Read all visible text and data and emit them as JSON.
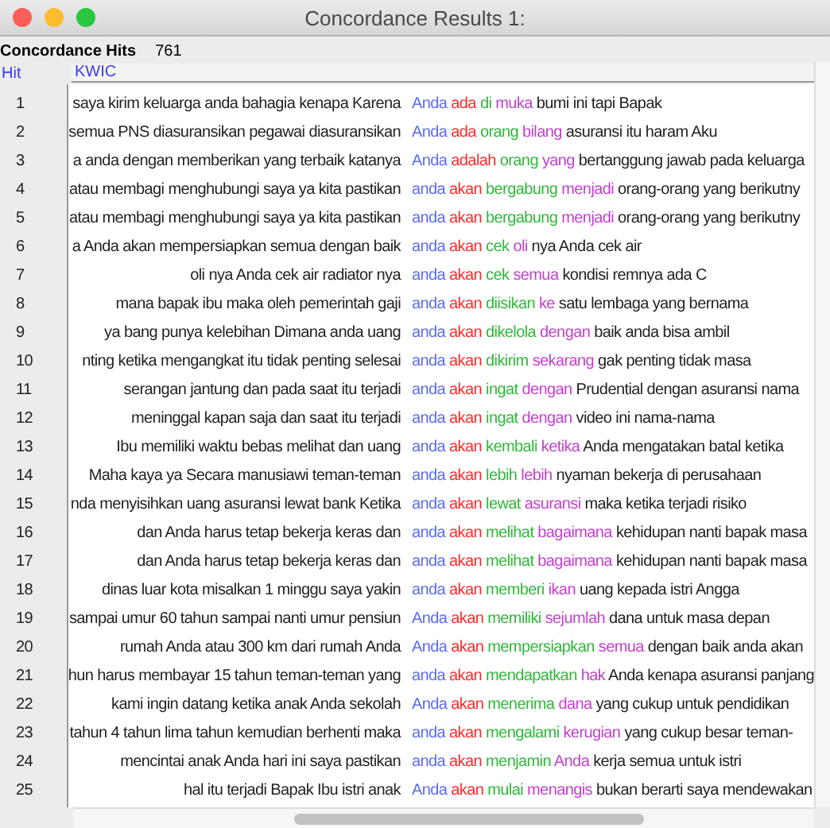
{
  "window": {
    "title": "Concordance Results 1:"
  },
  "summary": {
    "label": "Concordance Hits",
    "value": "761"
  },
  "table": {
    "columns": [
      "Hit",
      "KWIC"
    ],
    "rows": [
      {
        "hit": "1",
        "left": "saya kirim keluarga anda bahagia kenapa Karena",
        "tokens": [
          {
            "text": "Anda",
            "color": "#5a6cf2"
          },
          {
            "text": "ada",
            "color": "#ff2a2a"
          },
          {
            "text": "di",
            "color": "#2fb83a"
          },
          {
            "text": "muka",
            "color": "#c43fd0"
          }
        ],
        "right": "bumi ini tapi Bapak"
      },
      {
        "hit": "2",
        "left": "semua PNS diasuransikan pegawai diasuransikan",
        "tokens": [
          {
            "text": "Anda",
            "color": "#5a6cf2"
          },
          {
            "text": "ada",
            "color": "#ff2a2a"
          },
          {
            "text": "orang",
            "color": "#2fb83a"
          },
          {
            "text": "bilang",
            "color": "#c43fd0"
          }
        ],
        "right": "asuransi itu haram Aku"
      },
      {
        "hit": "3",
        "left": "a anda dengan memberikan yang terbaik katanya",
        "tokens": [
          {
            "text": "Anda",
            "color": "#5a6cf2"
          },
          {
            "text": "adalah",
            "color": "#ff2a2a"
          },
          {
            "text": "orang",
            "color": "#2fb83a"
          },
          {
            "text": "yang",
            "color": "#c43fd0"
          }
        ],
        "right": "bertanggung jawab pada keluarga"
      },
      {
        "hit": "4",
        "left": "atau membagi menghubungi saya ya kita pastikan",
        "tokens": [
          {
            "text": "anda",
            "color": "#5a6cf2"
          },
          {
            "text": "akan",
            "color": "#ff2a2a"
          },
          {
            "text": "bergabung",
            "color": "#2fb83a"
          },
          {
            "text": "menjadi",
            "color": "#c43fd0"
          }
        ],
        "right": "orang-orang yang berikutny"
      },
      {
        "hit": "5",
        "left": "atau membagi menghubungi saya ya kita pastikan",
        "tokens": [
          {
            "text": "anda",
            "color": "#5a6cf2"
          },
          {
            "text": "akan",
            "color": "#ff2a2a"
          },
          {
            "text": "bergabung",
            "color": "#2fb83a"
          },
          {
            "text": "menjadi",
            "color": "#c43fd0"
          }
        ],
        "right": "orang-orang yang berikutny"
      },
      {
        "hit": "6",
        "left": "a Anda akan mempersiapkan semua dengan baik",
        "tokens": [
          {
            "text": "anda",
            "color": "#5a6cf2"
          },
          {
            "text": "akan",
            "color": "#ff2a2a"
          },
          {
            "text": "cek",
            "color": "#2fb83a"
          },
          {
            "text": "oli",
            "color": "#c43fd0"
          }
        ],
        "right": "nya Anda cek air"
      },
      {
        "hit": "7",
        "left": "oli nya Anda cek air radiator nya",
        "tokens": [
          {
            "text": "anda",
            "color": "#5a6cf2"
          },
          {
            "text": "akan",
            "color": "#ff2a2a"
          },
          {
            "text": "cek",
            "color": "#2fb83a"
          },
          {
            "text": "semua",
            "color": "#c43fd0"
          }
        ],
        "right": "kondisi remnya ada C"
      },
      {
        "hit": "8",
        "left": "mana bapak ibu maka oleh pemerintah gaji",
        "tokens": [
          {
            "text": "anda",
            "color": "#5a6cf2"
          },
          {
            "text": "akan",
            "color": "#ff2a2a"
          },
          {
            "text": "diisikan",
            "color": "#2fb83a"
          },
          {
            "text": "ke",
            "color": "#c43fd0"
          }
        ],
        "right": "satu lembaga yang bernama"
      },
      {
        "hit": "9",
        "left": "ya bang punya kelebihan Dimana anda uang",
        "tokens": [
          {
            "text": "anda",
            "color": "#5a6cf2"
          },
          {
            "text": "akan",
            "color": "#ff2a2a"
          },
          {
            "text": "dikelola",
            "color": "#2fb83a"
          },
          {
            "text": "dengan",
            "color": "#c43fd0"
          }
        ],
        "right": "baik anda bisa ambil"
      },
      {
        "hit": "10",
        "left": "nting ketika mengangkat itu tidak penting selesai",
        "tokens": [
          {
            "text": "anda",
            "color": "#5a6cf2"
          },
          {
            "text": "akan",
            "color": "#ff2a2a"
          },
          {
            "text": "dikirim",
            "color": "#2fb83a"
          },
          {
            "text": "sekarang",
            "color": "#c43fd0"
          }
        ],
        "right": "gak penting tidak masa"
      },
      {
        "hit": "11",
        "left": "serangan jantung dan pada saat itu terjadi",
        "tokens": [
          {
            "text": "anda",
            "color": "#5a6cf2"
          },
          {
            "text": "akan",
            "color": "#ff2a2a"
          },
          {
            "text": "ingat",
            "color": "#2fb83a"
          },
          {
            "text": "dengan",
            "color": "#c43fd0"
          }
        ],
        "right": "Prudential dengan asuransi nama"
      },
      {
        "hit": "12",
        "left": "meninggal kapan saja dan saat itu terjadi",
        "tokens": [
          {
            "text": "anda",
            "color": "#5a6cf2"
          },
          {
            "text": "akan",
            "color": "#ff2a2a"
          },
          {
            "text": "ingat",
            "color": "#2fb83a"
          },
          {
            "text": "dengan",
            "color": "#c43fd0"
          }
        ],
        "right": "video ini nama-nama"
      },
      {
        "hit": "13",
        "left": "Ibu memiliki waktu bebas melihat dan uang",
        "tokens": [
          {
            "text": "anda",
            "color": "#5a6cf2"
          },
          {
            "text": "akan",
            "color": "#ff2a2a"
          },
          {
            "text": "kembali",
            "color": "#2fb83a"
          },
          {
            "text": "ketika",
            "color": "#c43fd0"
          }
        ],
        "right": "Anda mengatakan batal ketika"
      },
      {
        "hit": "14",
        "left": "Maha kaya ya Secara manusiawi teman-teman",
        "tokens": [
          {
            "text": "anda",
            "color": "#5a6cf2"
          },
          {
            "text": "akan",
            "color": "#ff2a2a"
          },
          {
            "text": "lebih",
            "color": "#2fb83a"
          },
          {
            "text": "lebih",
            "color": "#c43fd0"
          }
        ],
        "right": "nyaman bekerja di perusahaan"
      },
      {
        "hit": "15",
        "left": "nda menyisihkan uang asuransi lewat bank Ketika",
        "tokens": [
          {
            "text": "anda",
            "color": "#5a6cf2"
          },
          {
            "text": "akan",
            "color": "#ff2a2a"
          },
          {
            "text": "lewat",
            "color": "#2fb83a"
          },
          {
            "text": "asuransi",
            "color": "#c43fd0"
          }
        ],
        "right": "maka ketika terjadi risiko"
      },
      {
        "hit": "16",
        "left": "dan Anda harus tetap bekerja keras dan",
        "tokens": [
          {
            "text": "anda",
            "color": "#5a6cf2"
          },
          {
            "text": "akan",
            "color": "#ff2a2a"
          },
          {
            "text": "melihat",
            "color": "#2fb83a"
          },
          {
            "text": "bagaimana",
            "color": "#c43fd0"
          }
        ],
        "right": "kehidupan nanti bapak masa"
      },
      {
        "hit": "17",
        "left": "dan Anda harus tetap bekerja keras dan",
        "tokens": [
          {
            "text": "anda",
            "color": "#5a6cf2"
          },
          {
            "text": "akan",
            "color": "#ff2a2a"
          },
          {
            "text": "melihat",
            "color": "#2fb83a"
          },
          {
            "text": "bagaimana",
            "color": "#c43fd0"
          }
        ],
        "right": "kehidupan nanti bapak masa"
      },
      {
        "hit": "18",
        "left": "dinas luar kota misalkan 1 minggu saya yakin",
        "tokens": [
          {
            "text": "anda",
            "color": "#5a6cf2"
          },
          {
            "text": "akan",
            "color": "#ff2a2a"
          },
          {
            "text": "memberi",
            "color": "#2fb83a"
          },
          {
            "text": "ikan",
            "color": "#c43fd0"
          }
        ],
        "right": "uang kepada istri Angga"
      },
      {
        "hit": "19",
        "left": "sampai umur 60 tahun sampai nanti umur pensiun",
        "tokens": [
          {
            "text": "Anda",
            "color": "#5a6cf2"
          },
          {
            "text": "akan",
            "color": "#ff2a2a"
          },
          {
            "text": "memiliki",
            "color": "#2fb83a"
          },
          {
            "text": "sejumlah",
            "color": "#c43fd0"
          }
        ],
        "right": "dana untuk masa depan"
      },
      {
        "hit": "20",
        "left": "rumah Anda atau 300 km dari rumah Anda",
        "tokens": [
          {
            "text": "Anda",
            "color": "#5a6cf2"
          },
          {
            "text": "akan",
            "color": "#ff2a2a"
          },
          {
            "text": "mempersiapkan",
            "color": "#2fb83a"
          },
          {
            "text": "semua",
            "color": "#c43fd0"
          }
        ],
        "right": "dengan baik anda akan"
      },
      {
        "hit": "21",
        "left": "hun harus membayar 15 tahun teman-teman yang",
        "tokens": [
          {
            "text": "anda",
            "color": "#5a6cf2"
          },
          {
            "text": "akan",
            "color": "#ff2a2a"
          },
          {
            "text": "mendapatkan",
            "color": "#2fb83a"
          },
          {
            "text": "hak",
            "color": "#c43fd0"
          }
        ],
        "right": "Anda kenapa asuransi panjang"
      },
      {
        "hit": "22",
        "left": "kami ingin datang ketika anak Anda sekolah",
        "tokens": [
          {
            "text": "Anda",
            "color": "#5a6cf2"
          },
          {
            "text": "akan",
            "color": "#ff2a2a"
          },
          {
            "text": "menerima",
            "color": "#2fb83a"
          },
          {
            "text": "dana",
            "color": "#c43fd0"
          }
        ],
        "right": "yang cukup untuk pendidikan"
      },
      {
        "hit": "23",
        "left": "tahun 4 tahun lima tahun kemudian berhenti maka",
        "tokens": [
          {
            "text": "anda",
            "color": "#5a6cf2"
          },
          {
            "text": "akan",
            "color": "#ff2a2a"
          },
          {
            "text": "mengalami",
            "color": "#2fb83a"
          },
          {
            "text": "kerugian",
            "color": "#c43fd0"
          }
        ],
        "right": "yang cukup besar teman-"
      },
      {
        "hit": "24",
        "left": "mencintai anak Anda hari ini saya pastikan",
        "tokens": [
          {
            "text": "anda",
            "color": "#5a6cf2"
          },
          {
            "text": "akan",
            "color": "#ff2a2a"
          },
          {
            "text": "menjamin",
            "color": "#2fb83a"
          },
          {
            "text": "Anda",
            "color": "#c43fd0"
          }
        ],
        "right": "kerja semua untuk istri"
      },
      {
        "hit": "25",
        "left": "hal itu terjadi Bapak Ibu istri anak",
        "tokens": [
          {
            "text": "Anda",
            "color": "#5a6cf2"
          },
          {
            "text": "akan",
            "color": "#ff2a2a"
          },
          {
            "text": "mulai",
            "color": "#2fb83a"
          },
          {
            "text": "menangis",
            "color": "#c43fd0"
          }
        ],
        "right": "bukan berarti saya mendewakan"
      }
    ]
  }
}
